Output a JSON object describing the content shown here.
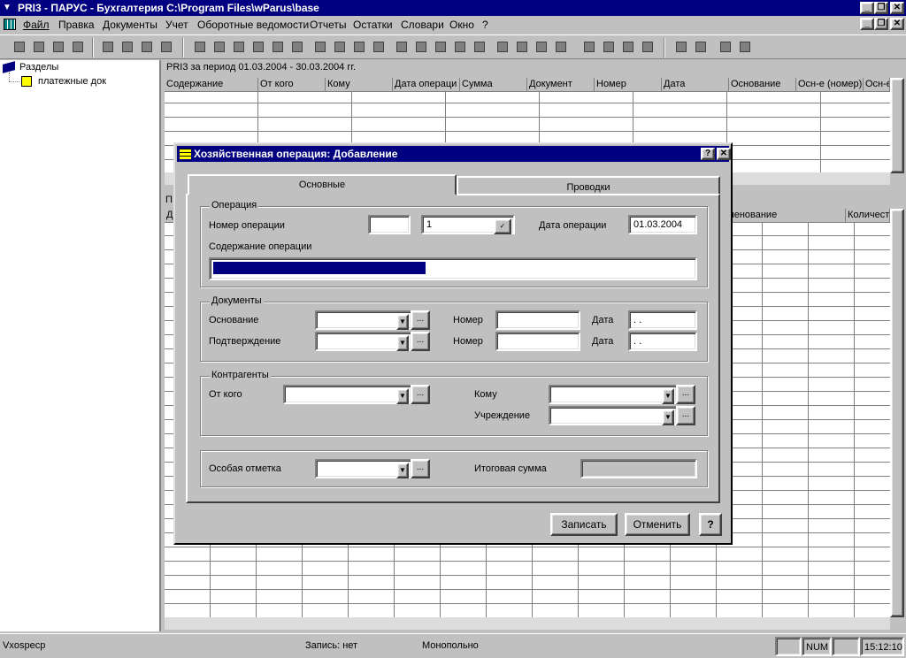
{
  "window": {
    "title": "PRI3 - ПАРУС - Бухгалтерия  C:\\Program Files\\wParus\\base"
  },
  "menu": [
    "Файл",
    "Правка",
    "Документы",
    "Учет",
    "Оборотные ведомости",
    "Отчеты",
    "Остатки",
    "Словари",
    "Окно",
    "?"
  ],
  "tree": {
    "root": "Разделы",
    "child": "платежные док"
  },
  "top_panel": {
    "caption": "PRI3 за период 01.03.2004 - 30.03.2004 гг.",
    "columns": [
      "Содержание",
      "От кого",
      "Кому",
      "Дата операци",
      "Сумма",
      "Документ",
      "Номер",
      "Дата",
      "Основание",
      "Осн-е (номер)",
      "Осн-е"
    ]
  },
  "bottom_panel": {
    "columns": [
      "Д",
      "",
      "",
      "",
      "",
      "",
      "",
      "",
      "",
      "именование",
      "Количест"
    ],
    "label_left": "П"
  },
  "dialog": {
    "title": "Хозяйственная операция: Добавление",
    "tabs": [
      "Основные",
      "Проводки"
    ],
    "operation": {
      "group": "Операция",
      "number_label": "Номер операции",
      "number_value": "",
      "number_suffix": "1",
      "date_label": "Дата операции",
      "date_value": "01.03.2004",
      "content_label": "Содержание операции"
    },
    "documents": {
      "group": "Документы",
      "basis_label": "Основание",
      "confirm_label": "Подтверждение",
      "number_label": "Номер",
      "date_label": "Дата",
      "date_empty": " .  ."
    },
    "contractors": {
      "group": "Контрагенты",
      "from_label": "От кого",
      "to_label": "Кому",
      "org_label": "Учреждение"
    },
    "special_label": "Особая отметка",
    "total_label": "Итоговая сумма",
    "save": "Записать",
    "cancel": "Отменить",
    "help": "?",
    "ellipsis": "..."
  },
  "status": {
    "left": "Vxospecp",
    "record": "Запись: нет",
    "mode": "Монопольно",
    "num": "NUM",
    "time": "15:12:10"
  }
}
